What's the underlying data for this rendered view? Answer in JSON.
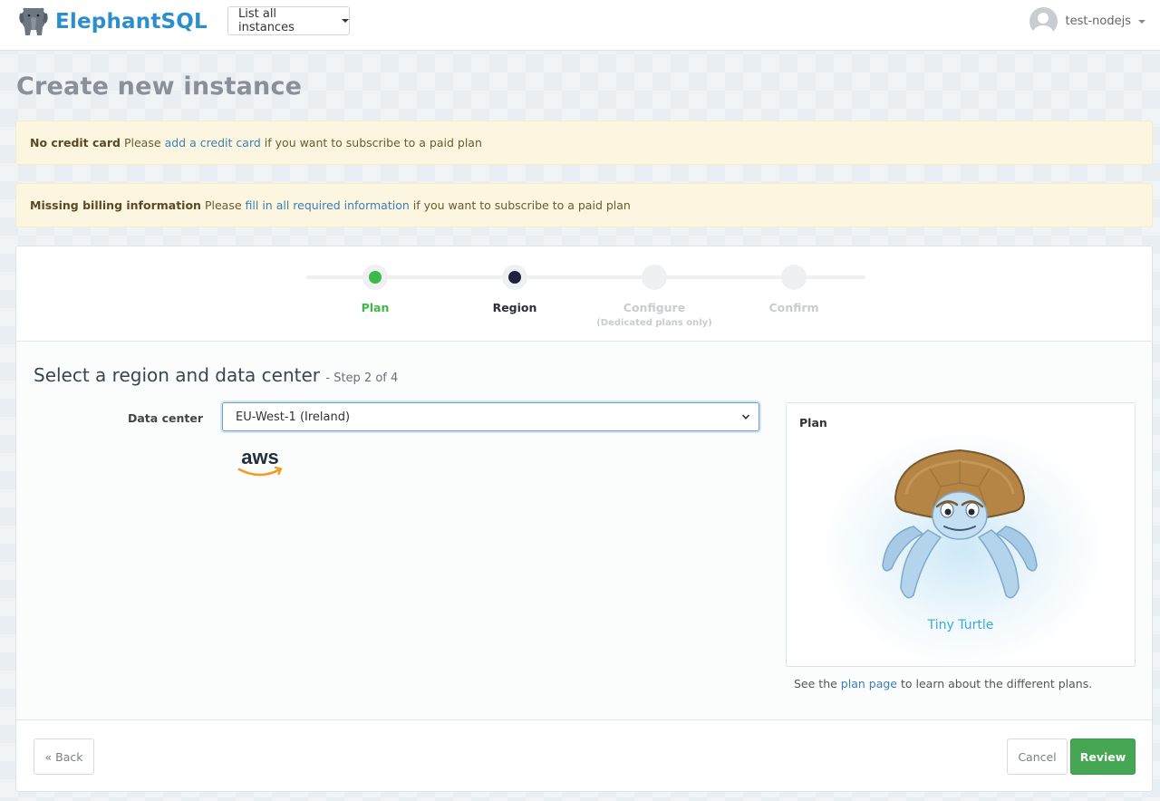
{
  "nav": {
    "brand": "ElephantSQL",
    "instances_dropdown": "List all instances",
    "username": "test-nodejs"
  },
  "page": {
    "title": "Create new instance"
  },
  "alerts": [
    {
      "strong": "No credit card",
      "before": "Please",
      "link": "add a credit card",
      "after": "if you want to subscribe to a paid plan"
    },
    {
      "strong": "Missing billing information",
      "before": "Please",
      "link": "fill in all required information",
      "after": "if you want to subscribe to a paid plan"
    }
  ],
  "steps": [
    {
      "label": "Plan",
      "state": "done",
      "color": "#3fb84a"
    },
    {
      "label": "Region",
      "state": "current",
      "color": "#1f2140"
    },
    {
      "label": "Configure",
      "sub": "(Dedicated plans only)",
      "state": "upcoming",
      "color": "#c9ccd0"
    },
    {
      "label": "Confirm",
      "state": "upcoming",
      "color": "#c9ccd0"
    }
  ],
  "region": {
    "title": "Select a region and data center",
    "step_note": "- Step 2 of 4",
    "data_center_label": "Data center",
    "data_center_value": "EU-West-1 (Ireland)",
    "provider_logo": "aws"
  },
  "plan": {
    "label": "Plan",
    "name": "Tiny Turtle",
    "note_before": "See the",
    "note_link": "plan page",
    "note_after": "to learn about the different plans."
  },
  "footer": {
    "back": "« Back",
    "cancel": "Cancel",
    "review": "Review"
  },
  "colors": {
    "brand": "#2b8fcd",
    "success": "#45a653",
    "link": "#3a7fb6",
    "alert_bg": "#fcf6e1"
  }
}
